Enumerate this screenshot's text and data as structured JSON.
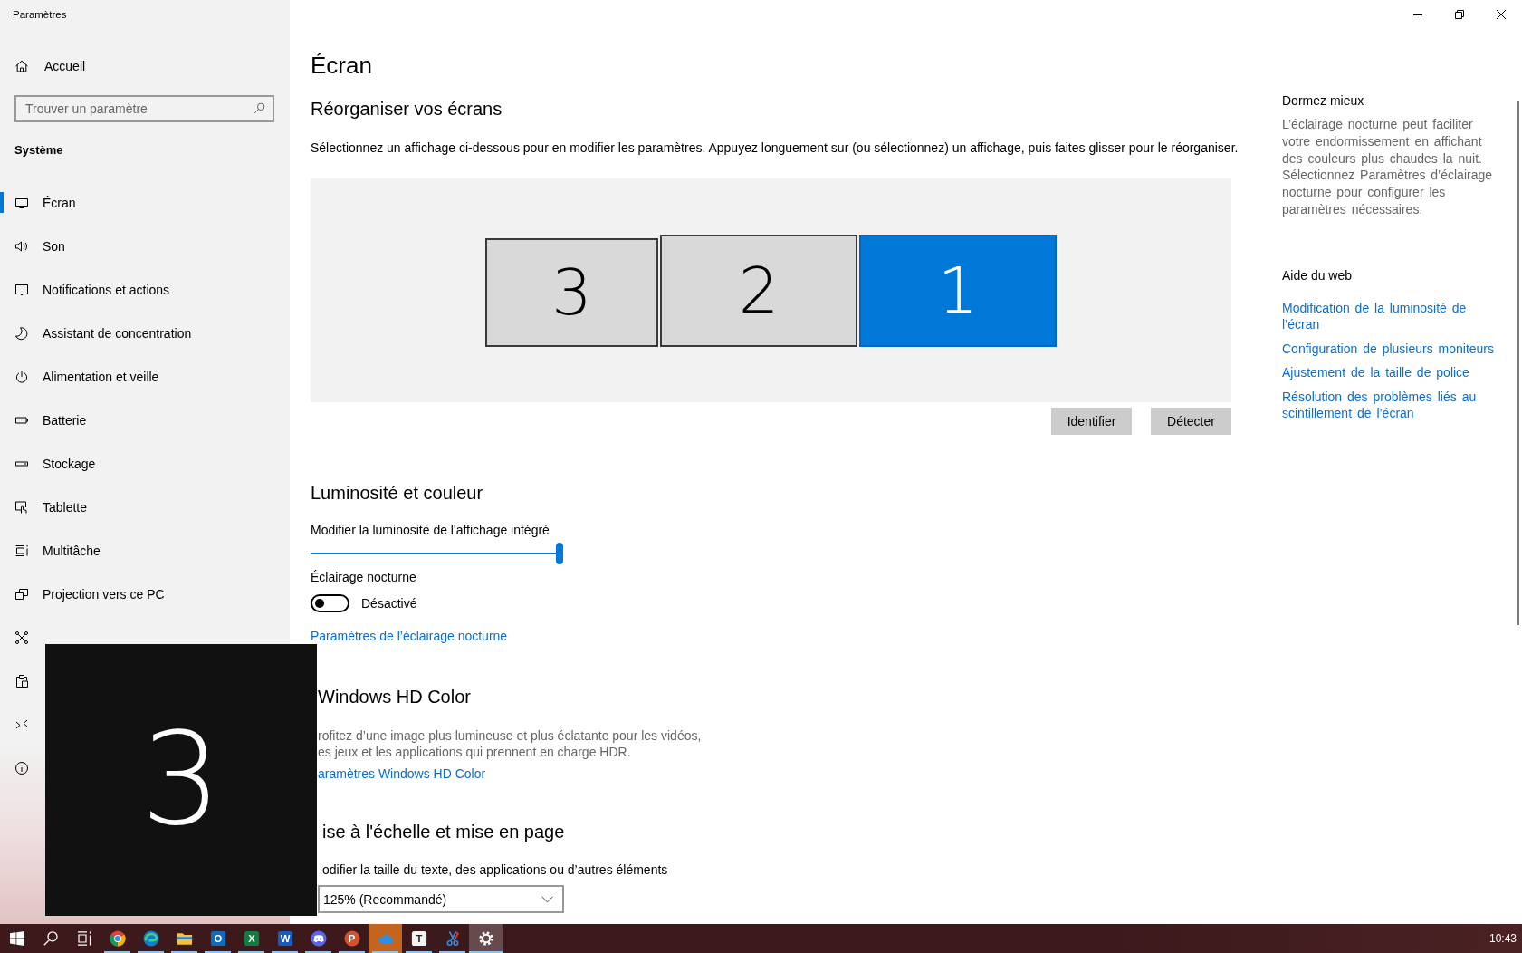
{
  "window": {
    "title": "Paramètres"
  },
  "sidebar": {
    "home": {
      "label": "Accueil"
    },
    "search": {
      "placeholder": "Trouver un paramètre"
    },
    "section": "Système",
    "items": [
      {
        "label": "Écran",
        "selected": true
      },
      {
        "label": "Son",
        "selected": false
      },
      {
        "label": "Notifications et actions",
        "selected": false
      },
      {
        "label": "Assistant de concentration",
        "selected": false
      },
      {
        "label": "Alimentation et veille",
        "selected": false
      },
      {
        "label": "Batterie",
        "selected": false
      },
      {
        "label": "Stockage",
        "selected": false
      },
      {
        "label": "Tablette",
        "selected": false
      },
      {
        "label": "Multitâche",
        "selected": false
      },
      {
        "label": "Projection vers ce PC",
        "selected": false
      },
      {
        "selected": false
      },
      {
        "selected": false
      },
      {
        "selected": false
      },
      {
        "selected": false
      }
    ]
  },
  "page": {
    "title": "Écran"
  },
  "arrange": {
    "heading": "Réorganiser vos écrans",
    "description": "Sélectionnez un affichage ci-dessous pour en modifier les paramètres. Appuyez longuement sur (ou sélectionnez) un affichage, puis faites glisser pour le réorganiser.",
    "monitors": [
      {
        "number": "3",
        "selected": false
      },
      {
        "number": "2",
        "selected": false
      },
      {
        "number": "1",
        "selected": true
      }
    ],
    "buttons": [
      "Identifier",
      "Détecter"
    ]
  },
  "brightness": {
    "heading": "Luminosité et couleur",
    "slider": {
      "label": "Modifier la luminosité de l'affichage intégré",
      "level": 1
    },
    "night_light": {
      "label": "Éclairage nocturne",
      "on": false,
      "state_text": "Désactivé"
    },
    "link": "Paramètres de l’éclairage nocturne"
  },
  "hd_color": {
    "heading": "Windows HD Color",
    "lines": [
      "rofitez d’une image plus lumineuse et plus éclatante pour les vidéos,",
      "es jeux et les applications qui prennent en charge HDR."
    ],
    "link": "aramètres Windows HD Color"
  },
  "scale": {
    "heading": "ise à l'échelle et mise en page",
    "label": "odifier la taille du texte, des applications ou d’autres éléments",
    "dropdown": {
      "value": "125% (Recommandé)"
    }
  },
  "aside": {
    "tip": {
      "heading": "Dormez mieux",
      "text": "L’éclairage nocturne peut faciliter votre endormissement en affichant des couleurs plus chaudes la nuit. Sélectionnez Paramètres d’éclairage nocturne pour configurer les paramètres nécessaires."
    },
    "help": {
      "heading": "Aide du web",
      "links": [
        "Modification de la luminosité de l’écran",
        "Configuration de plusieurs moniteurs",
        "Ajustement de la taille de police",
        "Résolution des problèmes liés au scintillement de l’écran"
      ]
    }
  },
  "identify_overlay": {
    "number": "3"
  },
  "taskbar": {
    "apps": [
      {
        "running": true,
        "selected": false,
        "flashing": false
      },
      {
        "running": true,
        "selected": false,
        "flashing": false
      },
      {
        "running": true,
        "selected": false,
        "flashing": false
      },
      {
        "glyph": "O",
        "running": true,
        "selected": false,
        "flashing": false
      },
      {
        "glyph": "X",
        "running": true,
        "selected": false,
        "flashing": false
      },
      {
        "glyph": "W",
        "running": true,
        "selected": false,
        "flashing": false
      },
      {
        "running": true,
        "selected": false,
        "flashing": false
      },
      {
        "glyph": "P",
        "running": true,
        "selected": false,
        "flashing": false
      },
      {
        "running": true,
        "selected": false,
        "flashing": true
      },
      {
        "glyph": "T",
        "running": true,
        "selected": false,
        "flashing": false
      },
      {
        "running": true,
        "selected": false,
        "flashing": false
      },
      {
        "running": true,
        "selected": true,
        "flashing": false
      }
    ],
    "clock": "10:43"
  }
}
